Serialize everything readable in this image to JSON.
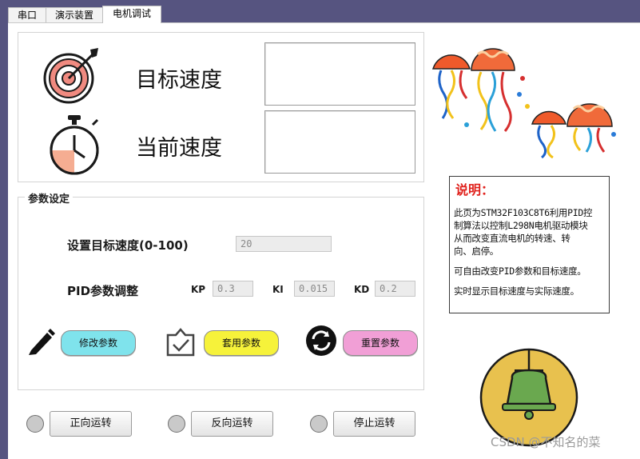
{
  "tabs": [
    {
      "label": "串口"
    },
    {
      "label": "演示装置"
    },
    {
      "label": "电机调试"
    }
  ],
  "speed_panel": {
    "target_label": "目标速度",
    "current_label": "当前速度",
    "target_value": "",
    "current_value": ""
  },
  "params": {
    "group_title": "参数设定",
    "set_target_label": "设置目标速度(0-100)",
    "target_input": "20",
    "pid_label": "PID参数调整",
    "kp_label": "KP",
    "kp_value": "0.3",
    "ki_label": "KI",
    "ki_value": "0.015",
    "kd_label": "KD",
    "kd_value": "0.2",
    "modify_button": "修改参数",
    "apply_button": "套用参数",
    "reset_button": "重置参数"
  },
  "motor": {
    "forward_button": "正向运转",
    "reverse_button": "反向运转",
    "stop_button": "停止运转"
  },
  "note": {
    "title": "说明：",
    "line1": "此页为STM32F103C8T6利用PID控",
    "line2": "制算法以控制L298N电机驱动模块",
    "line3": "从而改变直流电机的转速、转",
    "line4": "向、启停。",
    "line5": "可自由改变PID参数和目标速度。",
    "line6": "实时显示目标速度与实际速度。"
  },
  "watermark": "CSDN @不知名的菜",
  "colors": {
    "background": "#565480",
    "modify_button": "#7fe3ec",
    "apply_button": "#f6f23a",
    "reset_button": "#f19fd6",
    "bell_circle": "#e8c14e",
    "bell": "#6aa84f",
    "note_title": "#e0201b"
  },
  "icons": [
    "target-icon",
    "stopwatch-icon",
    "pencil-icon",
    "checkbox-icon",
    "refresh-icon",
    "bell-icon",
    "jellyfish-decoration"
  ]
}
